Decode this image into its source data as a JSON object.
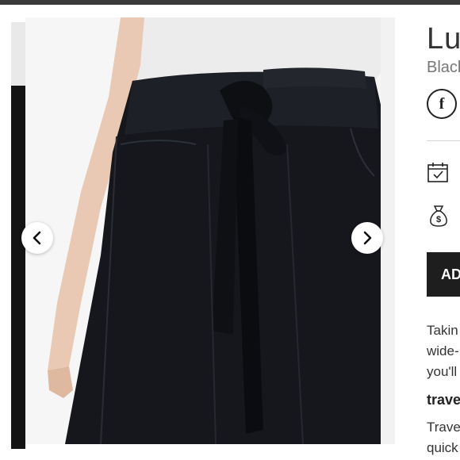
{
  "product": {
    "title": "Lu",
    "color": "Black",
    "add_button": "AD",
    "description_lines": [
      "Takin",
      "wide-",
      "you'll"
    ],
    "feature_title": "trave",
    "feature_lines": [
      "Trave",
      "quick"
    ]
  },
  "gallery": {
    "prev_icon": "chevron-left-icon",
    "next_icon": "chevron-right-icon"
  },
  "icons": {
    "share": "facebook-icon",
    "calendar": "calendar-check-icon",
    "money": "money-bag-icon"
  },
  "colors": {
    "topbar": "#3a3a3a",
    "button": "#1e1e1e"
  }
}
